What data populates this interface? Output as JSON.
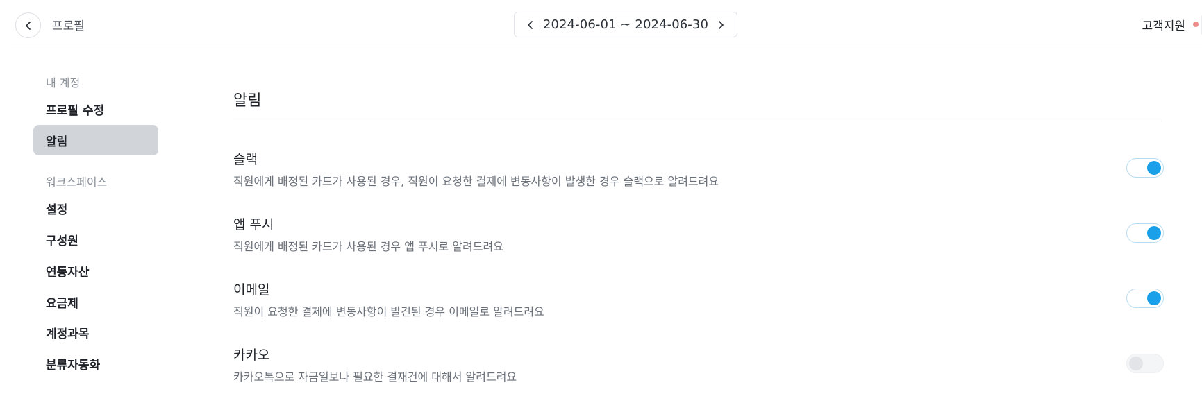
{
  "header": {
    "back_icon": "chevron-left-icon",
    "title": "프로필",
    "date_range": "2024-06-01 ~ 2024-06-30",
    "support_label": "고객지원",
    "support_dot_color": "#f08c8c"
  },
  "sidebar": {
    "account_label": "내 계정",
    "account_items": [
      {
        "label": "프로필 수정",
        "active": false
      },
      {
        "label": "알림",
        "active": true
      }
    ],
    "workspace_label": "워크스페이스",
    "workspace_items": [
      {
        "label": "설정"
      },
      {
        "label": "구성원"
      },
      {
        "label": "연동자산"
      },
      {
        "label": "요금제"
      },
      {
        "label": "계정과목"
      },
      {
        "label": "분류자동화"
      }
    ]
  },
  "main": {
    "title": "알림",
    "settings": [
      {
        "title": "슬랙",
        "description": "직원에게 배정된 카드가 사용된 경우, 직원이 요청한 결제에 변동사항이 발생한 경우 슬랙으로 알려드려요",
        "enabled": true
      },
      {
        "title": "앱 푸시",
        "description": "직원에게 배정된 카드가 사용된 경우 앱 푸시로 알려드려요",
        "enabled": true
      },
      {
        "title": "이메일",
        "description": "직원이 요청한 결제에 변동사항이 발견된 경우 이메일로 알려드려요",
        "enabled": true
      },
      {
        "title": "카카오",
        "description": "카카오톡으로 자금일보나 필요한 결재건에 대해서 알려드려요",
        "enabled": false
      }
    ]
  },
  "colors": {
    "accent": "#1aa0e8",
    "active_sidebar_bg": "#d1d5da"
  }
}
